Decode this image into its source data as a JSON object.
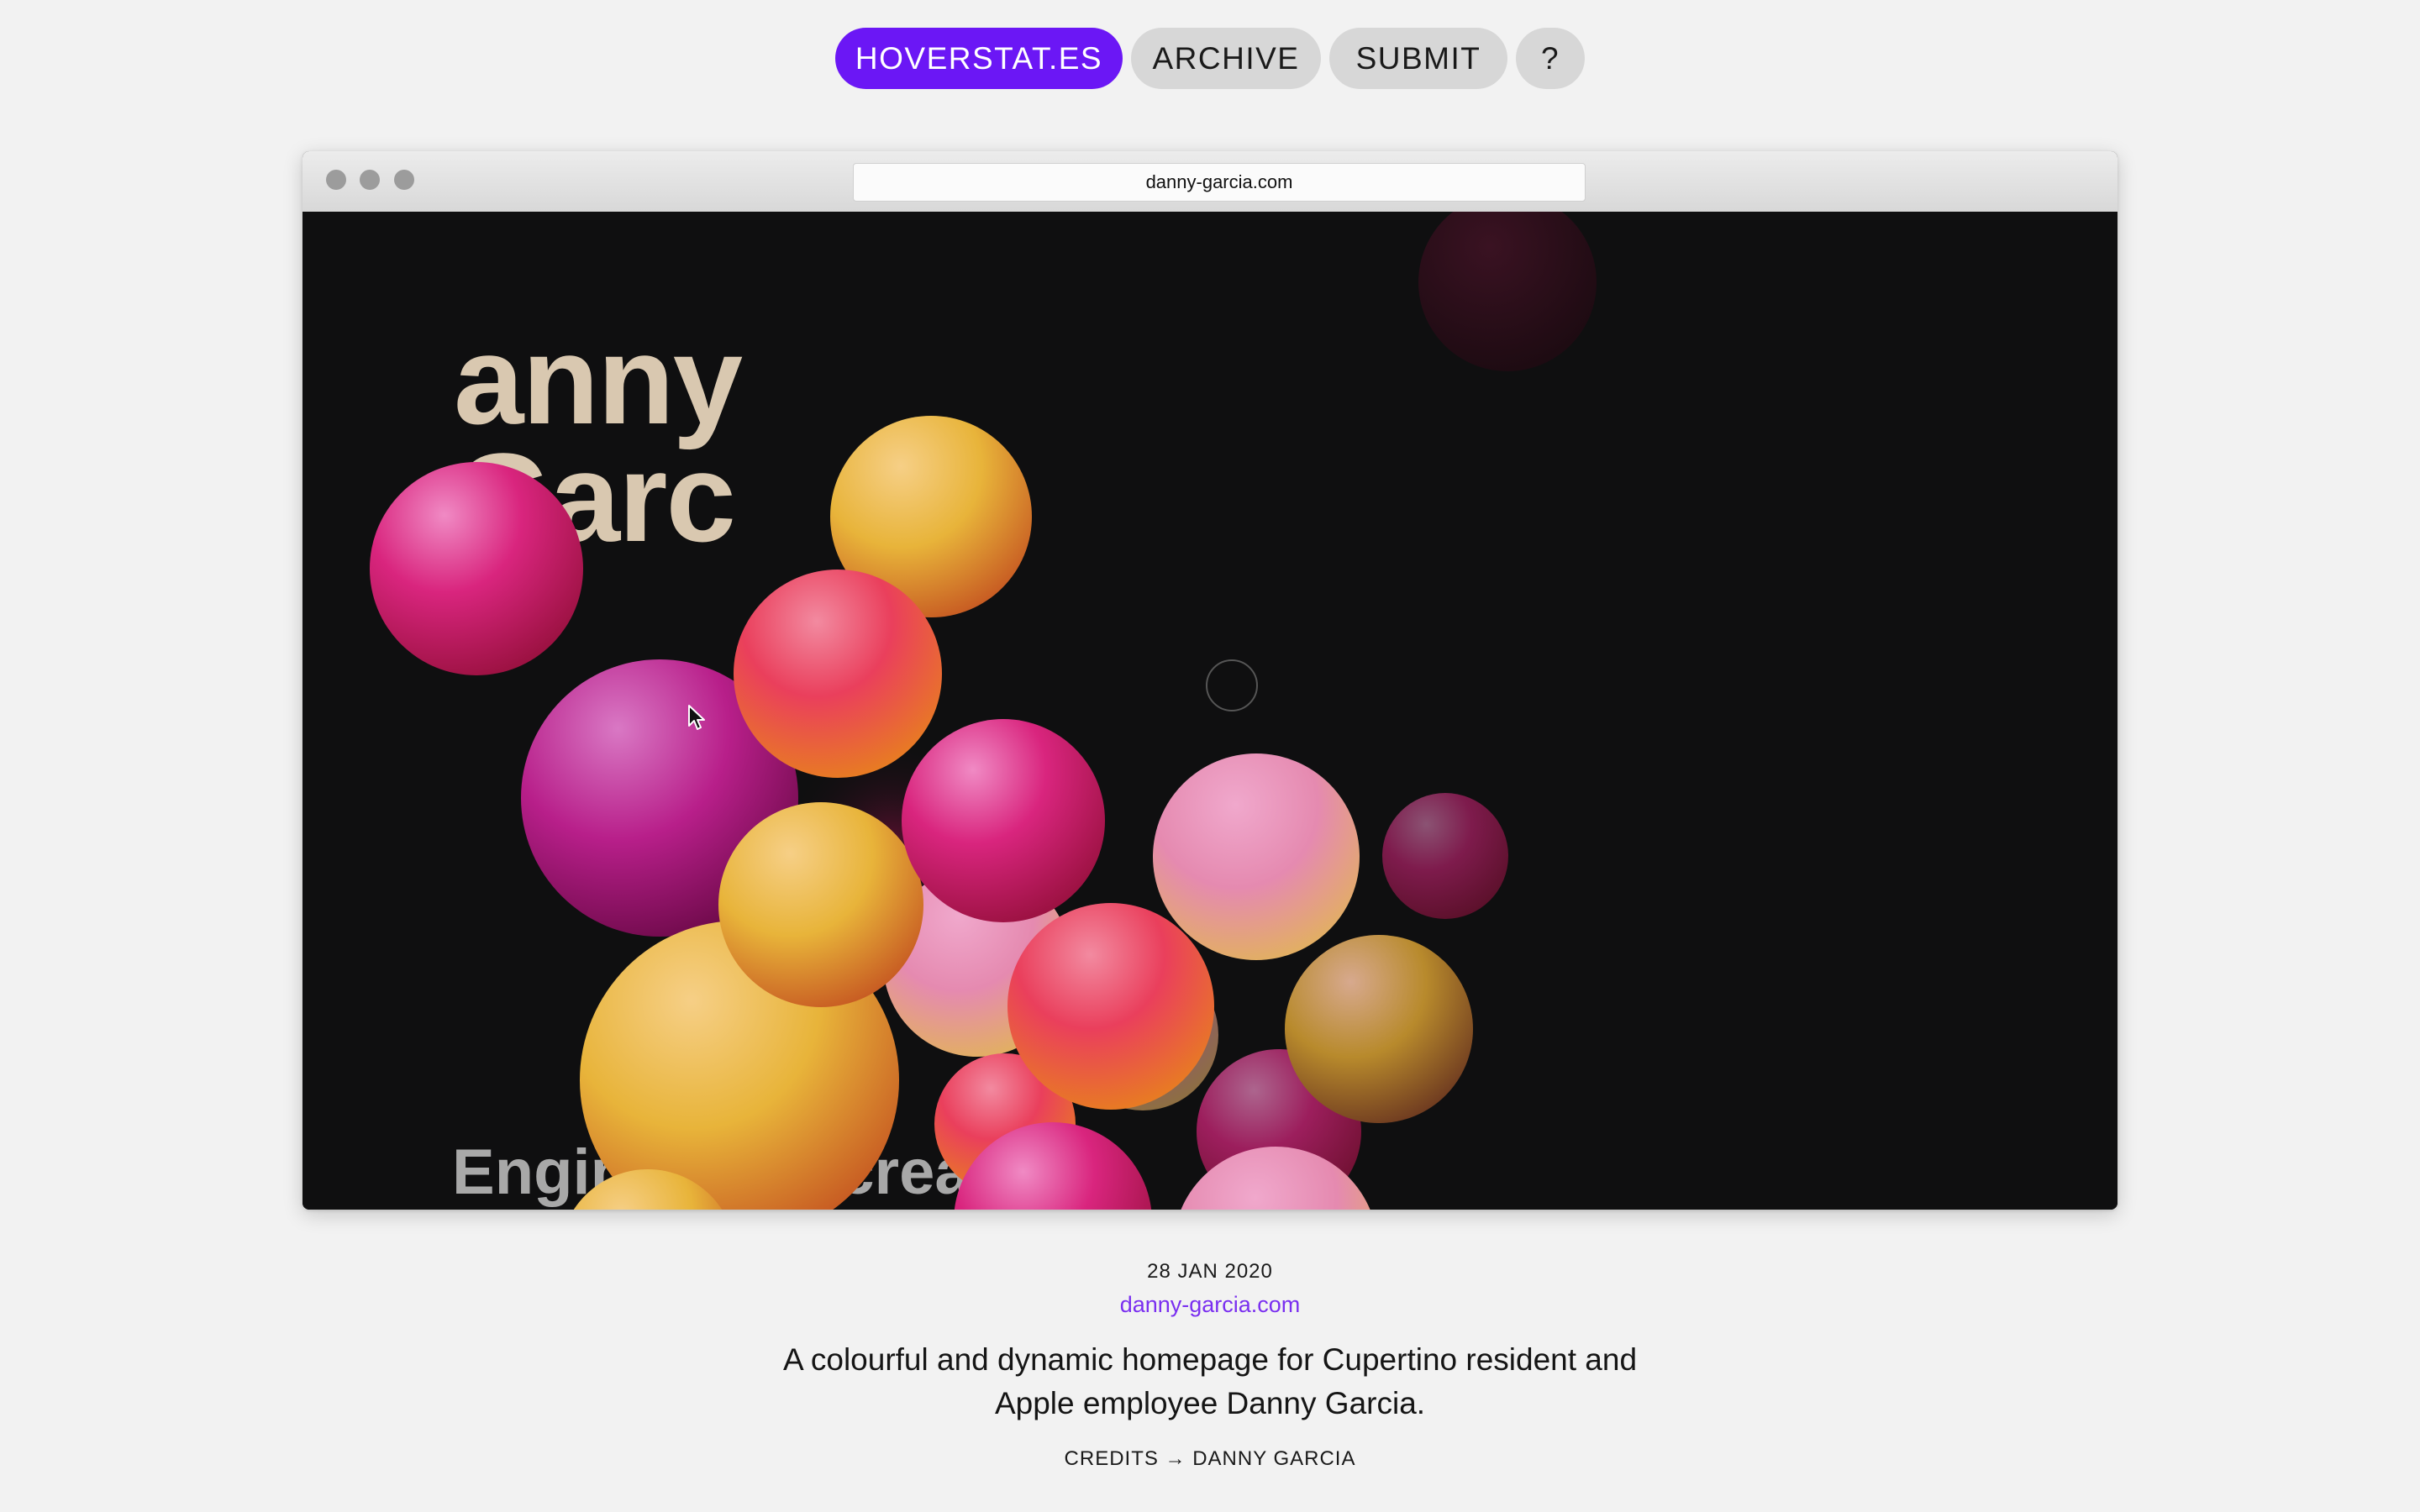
{
  "nav": {
    "brand": "HOVERSTAT.ES",
    "archive": "ARCHIVE",
    "submit": "SUBMIT",
    "help": "?",
    "brand_color": "#6b17f5",
    "pill_color": "#d7d7d7"
  },
  "browser": {
    "url": "danny-garcia.com"
  },
  "preview": {
    "headline": "anny\nGarc",
    "tagline": "Engineering creati"
  },
  "entry": {
    "date": "28 JAN 2020",
    "site": "danny-garcia.com",
    "description": "A colourful and dynamic homepage for Cupertino resident and Apple employee Danny Garcia.",
    "credits": "CREDITS → DANNY GARCIA",
    "link_color": "#7a2ff0"
  },
  "icons": {
    "window_controls": [
      "window-close-icon",
      "window-minimize-icon",
      "window-zoom-icon"
    ],
    "cursor": "arrow-cursor-icon"
  }
}
